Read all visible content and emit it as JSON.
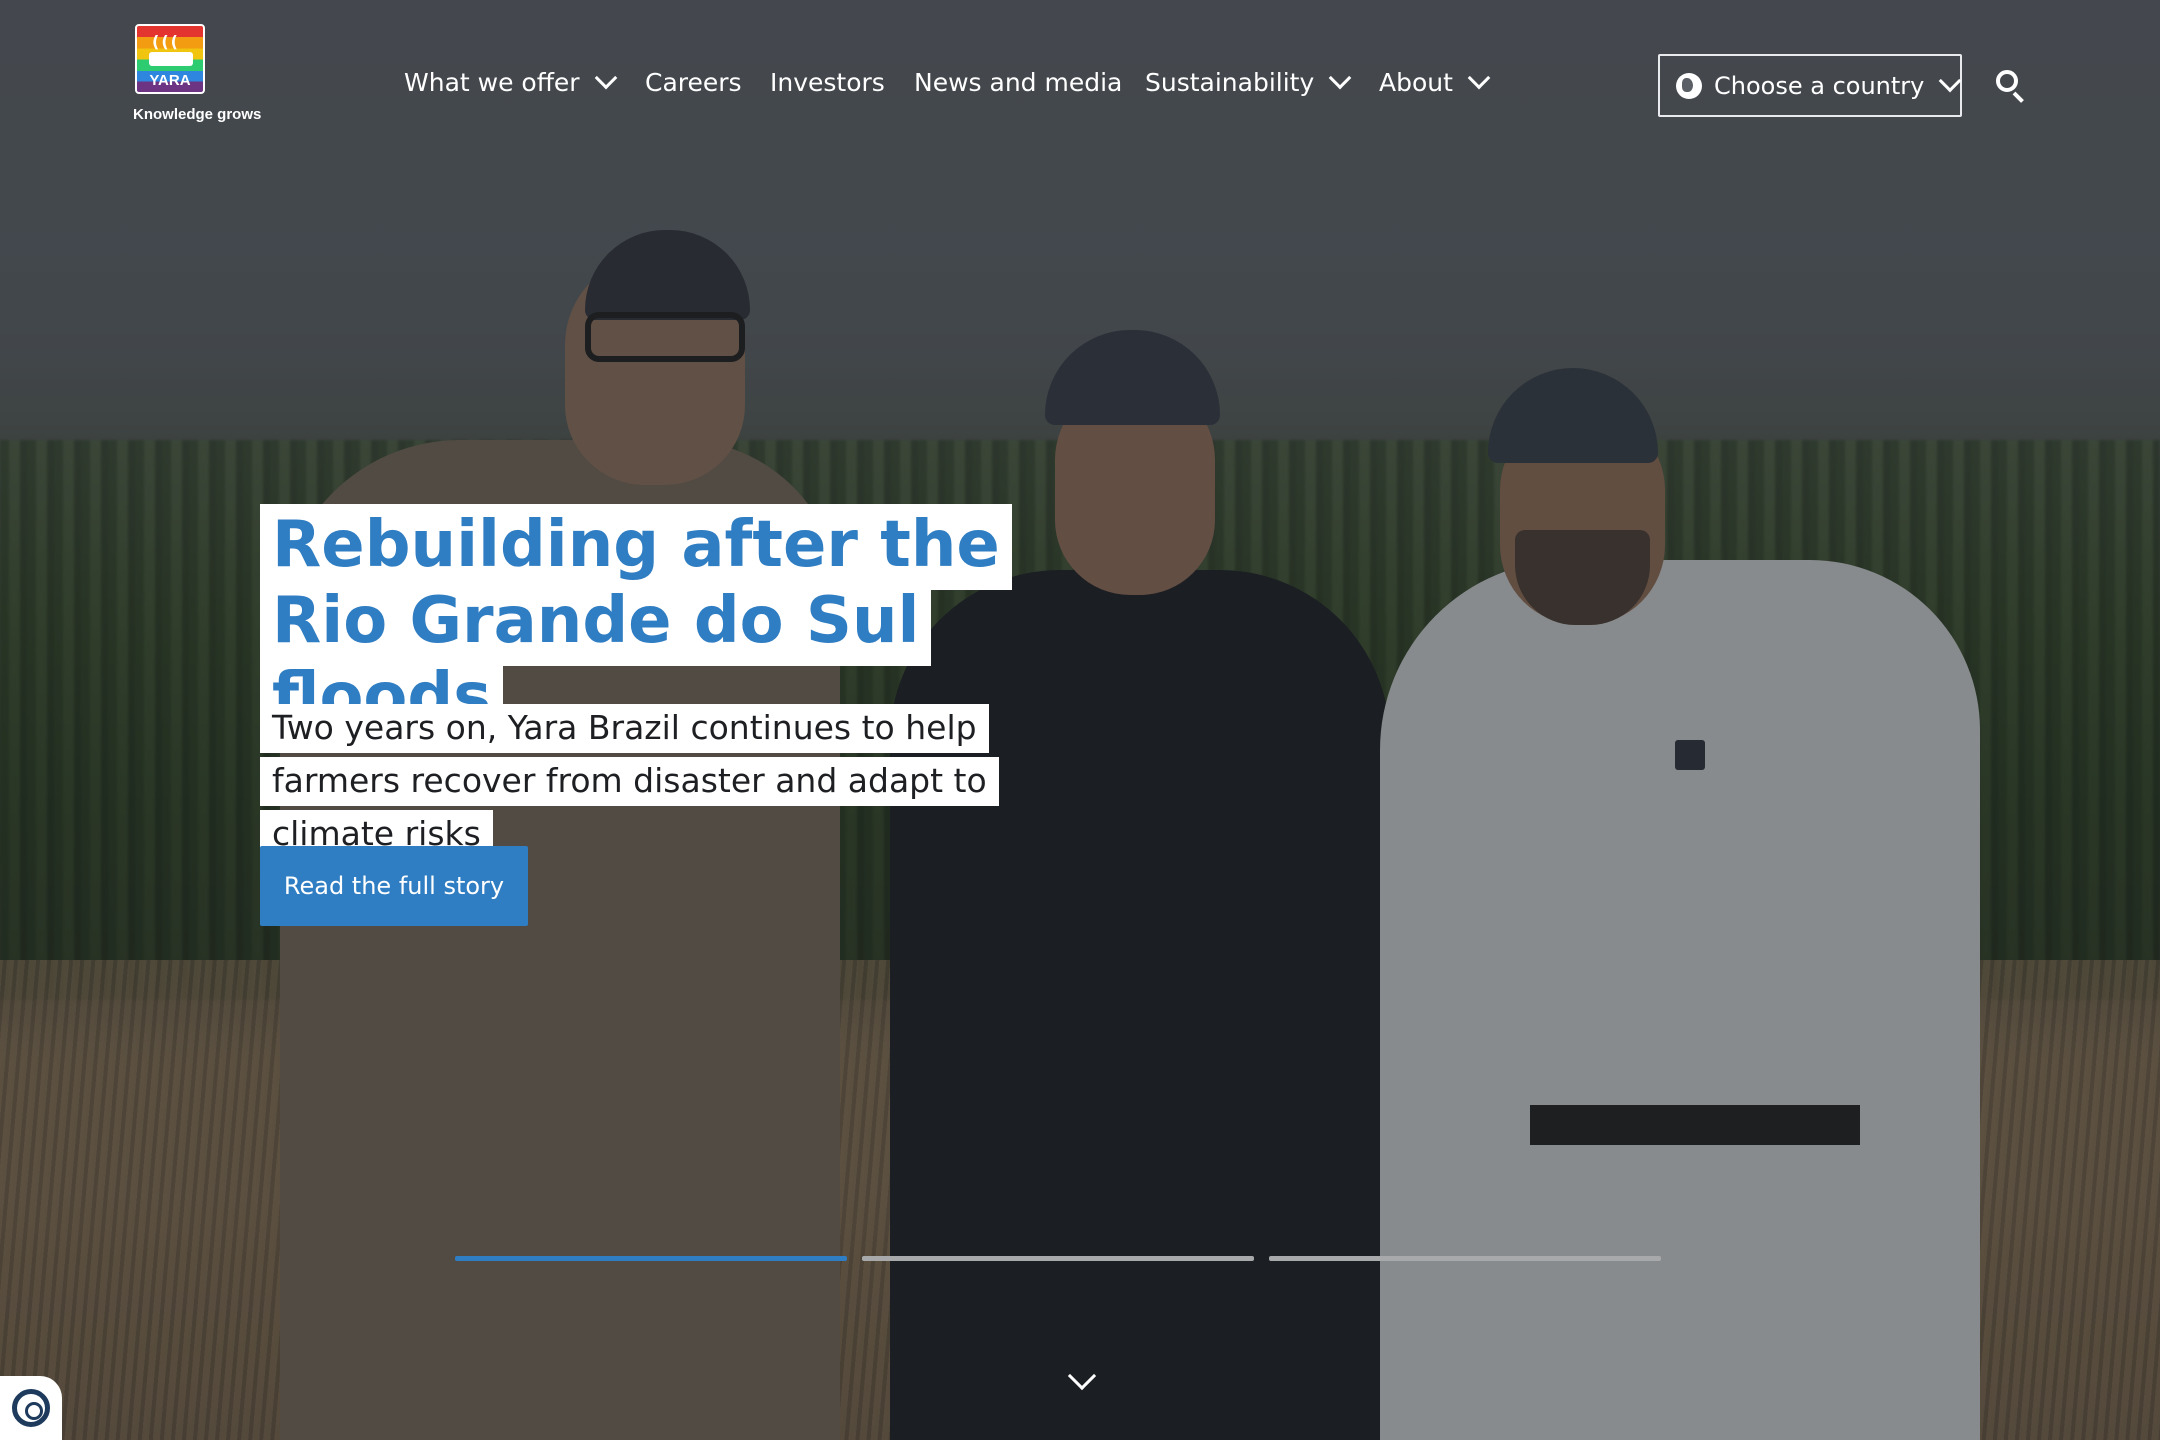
{
  "brand": {
    "logo_text": "YARA",
    "tagline": "Knowledge grows"
  },
  "nav": {
    "items": [
      {
        "label": "What we offer",
        "has_dropdown": true
      },
      {
        "label": "Careers",
        "has_dropdown": false
      },
      {
        "label": "Investors",
        "has_dropdown": false
      },
      {
        "label": "News and media",
        "has_dropdown": false
      },
      {
        "label": "Sustainability",
        "has_dropdown": true
      },
      {
        "label": "About",
        "has_dropdown": true
      }
    ],
    "country_selector": "Choose a country",
    "icons": [
      "globe-icon",
      "chevron-down-icon",
      "search-icon"
    ]
  },
  "hero": {
    "headline": "Rebuilding after the Rio Grande do Sul floods",
    "subheadline": "Two years on, Yara Brazil continues to help farmers recover from disaster and adapt to climate risks",
    "cta_label": "Read the full story",
    "slides_total": 3,
    "active_slide": 1
  },
  "colors": {
    "accent": "#2f7dc2",
    "headline_bg": "#ffffff",
    "indicator_inactive": "#a8a9ab"
  },
  "widgets": {
    "accessibility_icon": "accessibility-icon",
    "scroll_icon": "chevron-down-icon"
  }
}
